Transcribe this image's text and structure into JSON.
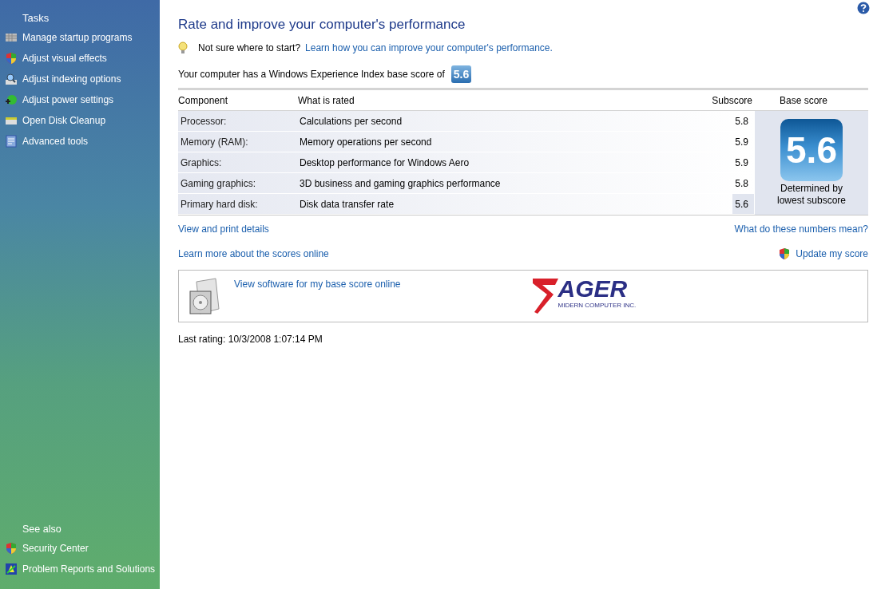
{
  "sidebar": {
    "tasks_heading": "Tasks",
    "tasks": [
      {
        "label": "Manage startup programs",
        "kind": "startup"
      },
      {
        "label": "Adjust visual effects",
        "kind": "shield"
      },
      {
        "label": "Adjust indexing options",
        "kind": "indexing"
      },
      {
        "label": "Adjust power settings",
        "kind": "power"
      },
      {
        "label": "Open Disk Cleanup",
        "kind": "disk"
      },
      {
        "label": "Advanced tools",
        "kind": "tools"
      }
    ],
    "see_also_heading": "See also",
    "see_also": [
      {
        "label": "Security Center",
        "kind": "shield"
      },
      {
        "label": "Problem Reports and Solutions",
        "kind": "report"
      }
    ]
  },
  "title": "Rate and improve your computer's performance",
  "tip": {
    "text": "Not sure where to start?",
    "link": "Learn how you can improve your computer's performance."
  },
  "summary": {
    "text": "Your computer has a Windows Experience Index base score of",
    "score": "5.6"
  },
  "table": {
    "columns": [
      "Component",
      "What is rated",
      "Subscore",
      "Base score"
    ],
    "rows": [
      {
        "component": "Processor:",
        "rated": "Calculations per second",
        "subscore": "5.8",
        "lowest": false
      },
      {
        "component": "Memory (RAM):",
        "rated": "Memory operations per second",
        "subscore": "5.9",
        "lowest": false
      },
      {
        "component": "Graphics:",
        "rated": "Desktop performance for Windows Aero",
        "subscore": "5.9",
        "lowest": false
      },
      {
        "component": "Gaming graphics:",
        "rated": "3D business and gaming graphics performance",
        "subscore": "5.8",
        "lowest": false
      },
      {
        "component": "Primary hard disk:",
        "rated": "Disk data transfer rate",
        "subscore": "5.6",
        "lowest": true
      }
    ],
    "base_score": "5.6",
    "base_note": "Determined by lowest subscore"
  },
  "links": {
    "details": "View and print details",
    "meaning": "What do these numbers mean?",
    "learn": "Learn more about the scores online",
    "update": "Update my score"
  },
  "software": {
    "link": "View software for my base score online",
    "logo_main": "AGER",
    "logo_sub": "MIDERN COMPUTER INC."
  },
  "last_rating": "Last rating: 10/3/2008 1:07:14 PM"
}
